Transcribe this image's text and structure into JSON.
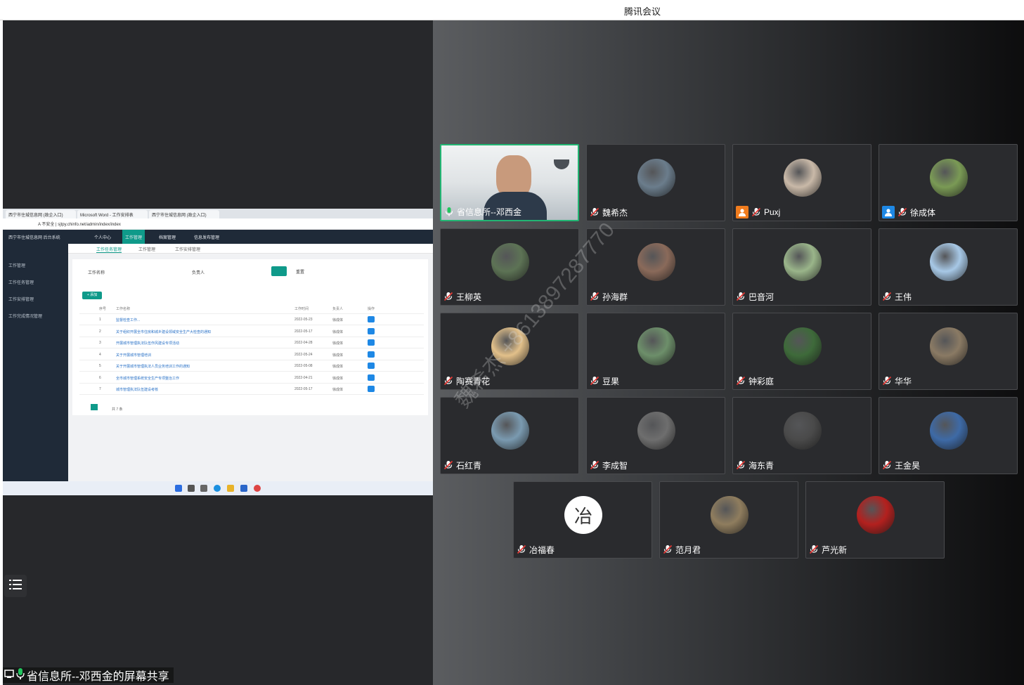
{
  "window": {
    "title": "腾讯会议"
  },
  "share": {
    "caption": "省信息所--邓西金的屏幕共享",
    "browser_tabs": [
      "西宁市住城信息网 (政企入口)",
      "Microsoft Word - 工作安排表",
      "西宁市住城信息网 (政企入口)"
    ],
    "url": "A 不安全 | sjtpy.chinfo.net/admin/index/index",
    "app_brand": "西宁市住城信息网 后台系统",
    "nav": [
      "个人中心",
      "工作管理",
      "档案管理",
      "信息发布管理"
    ],
    "sidebar": [
      "工作管理",
      "工作任务管理",
      "工作安排管理",
      "工作完成情况管理"
    ],
    "content_tabs": [
      "工作任务管理",
      "工作管理",
      "工作安排管理"
    ],
    "filters": {
      "title_label": "工作名称",
      "person_label": "负责人",
      "search_icon": "search-icon",
      "reset": "重置"
    },
    "add_label": "+ 添加",
    "table": {
      "headers": [
        "序号",
        "工作名称",
        "工作时间",
        "负责人",
        "操作"
      ],
      "rows": [
        {
          "idx": "1",
          "name": "监督检查工作...",
          "date": "2022-05-23",
          "who": "徐成体"
        },
        {
          "idx": "2",
          "name": "关于组织开展全市住房和城乡建设领域安全生产大检查的通知",
          "date": "2022-05-17",
          "who": "徐成体"
        },
        {
          "idx": "3",
          "name": "开展城市管理执法队伍作风建设专项活动",
          "date": "2022-04-28",
          "who": "徐成体"
        },
        {
          "idx": "4",
          "name": "关于开展城市管理培训",
          "date": "2022-05-24",
          "who": "徐成体"
        },
        {
          "idx": "5",
          "name": "关于开展城市管理执法人员业务培训工作的通知",
          "date": "2022-05-08",
          "who": "徐成体"
        },
        {
          "idx": "6",
          "name": "全市城市管理系统安全生产专项整治工作",
          "date": "2022-04-21",
          "who": "徐成体"
        },
        {
          "idx": "7",
          "name": "城市管理执法队伍建设考核",
          "date": "2022-05-17",
          "who": "徐成体"
        }
      ],
      "pager": "共 7 条"
    },
    "watermark": "魏希杰 +8613897287770"
  },
  "participants": [
    {
      "name": "省信息所--邓西金",
      "speaking": true,
      "video": true
    },
    {
      "name": "魏希杰",
      "color": "#6b7d8c"
    },
    {
      "name": "Puxj",
      "color": "#c9b9a8",
      "host": "#f07c1e"
    },
    {
      "name": "徐成体",
      "color": "#7a9a55",
      "host": "#1e88e5"
    },
    {
      "name": "王柳英",
      "color": "#5d7355"
    },
    {
      "name": "孙海群",
      "color": "#8a6a5a"
    },
    {
      "name": "巴音河",
      "color": "#9ab58a"
    },
    {
      "name": "王伟",
      "color": "#a7c8e6"
    },
    {
      "name": "陶赛青花",
      "color": "#e2c08a"
    },
    {
      "name": "豆果",
      "color": "#6d8f6a"
    },
    {
      "name": "钟彩庭",
      "color": "#3e6a3a"
    },
    {
      "name": "华华",
      "color": "#8a7a64"
    },
    {
      "name": "石红青",
      "color": "#7a9ab0"
    },
    {
      "name": "李成智",
      "color": "#6e6e6e"
    },
    {
      "name": "海东青",
      "color": "#4a4a4a"
    },
    {
      "name": "王金昊",
      "color": "#3e6aa6"
    },
    {
      "name": "冶福春",
      "color": "#ffffff",
      "logo_text": "冶"
    },
    {
      "name": "范月君",
      "color": "#8f7d5e"
    },
    {
      "name": "芦光新",
      "color": "#b3201e"
    }
  ],
  "icons": {
    "mic_muted": "mic-muted-icon",
    "mic_active": "mic-active-icon",
    "member_list": "list-icon",
    "share": "screen-share-icon"
  }
}
